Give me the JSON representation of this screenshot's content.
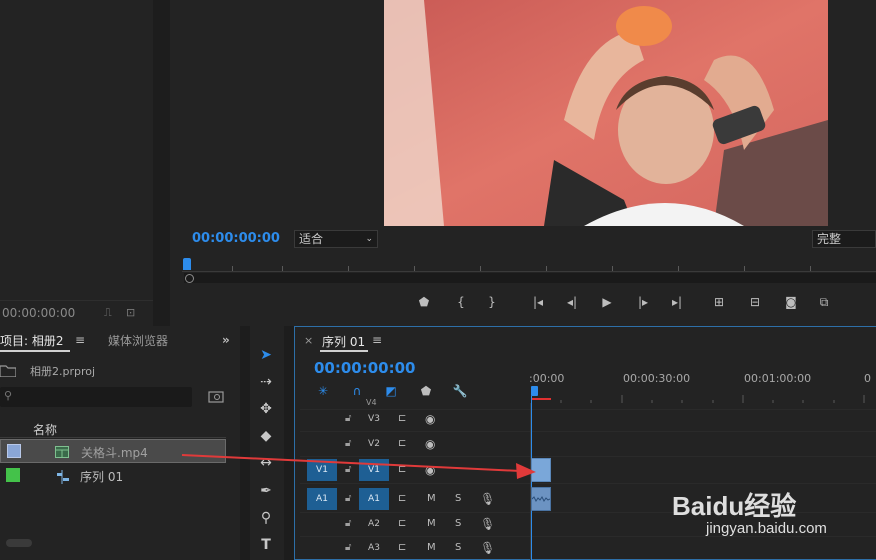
{
  "source_monitor": {
    "timecode": "00:00:00:00"
  },
  "program_monitor": {
    "timecode": "00:00:00:00",
    "fit_select": "适合",
    "quality_select": "完整",
    "transport_icons": [
      "marker-icon",
      "in-point-icon",
      "out-point-icon",
      "go-to-in-icon",
      "step-back-icon",
      "play-icon",
      "step-forward-icon",
      "go-to-out-icon",
      "lift-icon",
      "extract-icon",
      "camera-icon",
      "comparison-icon"
    ]
  },
  "project_panel": {
    "tab_label": "项目: 相册2",
    "media_browser_label": "媒体浏览器",
    "project_file": "相册2.prproj",
    "column_name": "名称",
    "items": [
      {
        "label": "关格斗.mp4",
        "swatch": "#8aa6d6"
      },
      {
        "label": "序列 01",
        "swatch": "#44c24a"
      }
    ]
  },
  "timeline": {
    "tab_label": "序列 01",
    "close_label": "×",
    "timecode": "00:00:00:00",
    "ruler_labels": [
      ":00:00",
      "00:00:30:00",
      "00:01:00:00",
      "0"
    ],
    "tracks": [
      {
        "name": "V4",
        "kind": "video"
      },
      {
        "name": "V3",
        "kind": "video"
      },
      {
        "name": "V2",
        "kind": "video"
      },
      {
        "name": "V1",
        "kind": "video",
        "source": "V1"
      },
      {
        "name": "A1",
        "kind": "audio",
        "source": "A1",
        "m": "M",
        "s": "S"
      },
      {
        "name": "A2",
        "kind": "audio",
        "m": "M",
        "s": "S"
      },
      {
        "name": "A3",
        "kind": "audio",
        "m": "M",
        "s": "S"
      }
    ]
  },
  "watermark": {
    "brand": "Baidu经验",
    "url": "jingyan.baidu.com"
  },
  "colors": {
    "accent": "#2d8ceb",
    "track_target": "#1e5f94",
    "annotation_arrow": "#e03a3a"
  }
}
